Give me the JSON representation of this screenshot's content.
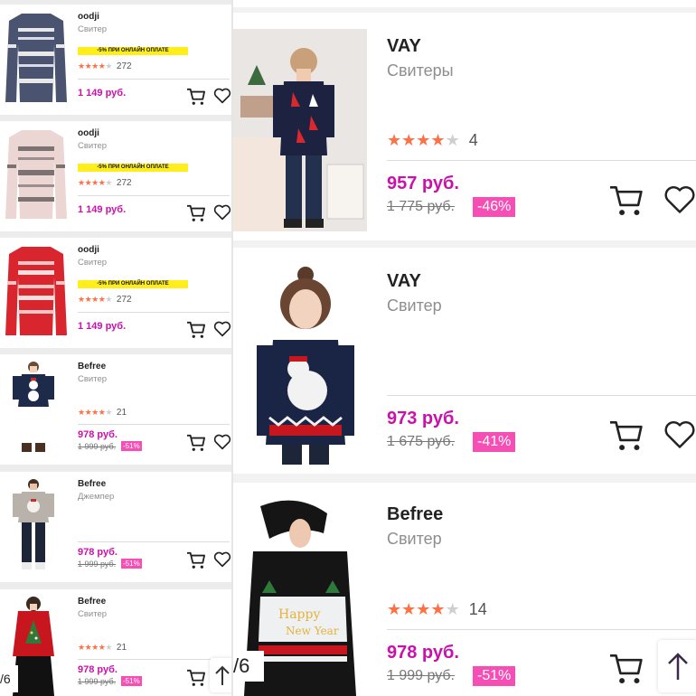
{
  "left_products": [
    {
      "brand": "oodji",
      "category": "Свитер",
      "promo": "-5% ПРИ ОНЛАЙН ОПЛАТЕ",
      "rating": 4,
      "reviews": "272",
      "price": "1 149 руб.",
      "old_price": "",
      "discount": ""
    },
    {
      "brand": "oodji",
      "category": "Свитер",
      "promo": "-5% ПРИ ОНЛАЙН ОПЛАТЕ",
      "rating": 4,
      "reviews": "272",
      "price": "1 149 руб.",
      "old_price": "",
      "discount": ""
    },
    {
      "brand": "oodji",
      "category": "Свитер",
      "promo": "-5% ПРИ ОНЛАЙН ОПЛАТЕ",
      "rating": 4,
      "reviews": "272",
      "price": "1 149 руб.",
      "old_price": "",
      "discount": ""
    },
    {
      "brand": "Befree",
      "category": "Свитер",
      "promo": "",
      "rating": 4,
      "reviews": "21",
      "price": "978 руб.",
      "old_price": "1 999 руб.",
      "discount": "-51%"
    },
    {
      "brand": "Befree",
      "category": "Джемпер",
      "promo": "",
      "rating": 0,
      "reviews": "",
      "price": "978 руб.",
      "old_price": "1 999 руб.",
      "discount": "-51%"
    },
    {
      "brand": "Befree",
      "category": "Свитер",
      "promo": "",
      "rating": 4,
      "reviews": "21",
      "price": "978 руб.",
      "old_price": "1 999 руб.",
      "discount": "-51%"
    }
  ],
  "right_products": [
    {
      "brand": "VAY",
      "category": "Свитеры",
      "rating": 4,
      "reviews": "4",
      "price": "957 руб.",
      "old_price": "1 775 руб.",
      "discount": "-46%"
    },
    {
      "brand": "VAY",
      "category": "Свитер",
      "rating": 0,
      "reviews": "",
      "price": "973 руб.",
      "old_price": "1 675 руб.",
      "discount": "-41%"
    },
    {
      "brand": "Befree",
      "category": "Свитер",
      "rating": 4,
      "reviews": "14",
      "price": "978 руб.",
      "old_price": "1 999 руб.",
      "discount": "-51%"
    }
  ],
  "pager_left": "/6",
  "pager_right": "/6",
  "icons": {
    "cart": "cart-icon",
    "wishlist": "heart-icon",
    "scroll_up": "arrow-up-icon",
    "star": "star-icon"
  },
  "colors": {
    "price": "#cb11ab",
    "discount_badge": "#f54fb6",
    "star": "#ff7043",
    "promo": "#ffee1a"
  }
}
